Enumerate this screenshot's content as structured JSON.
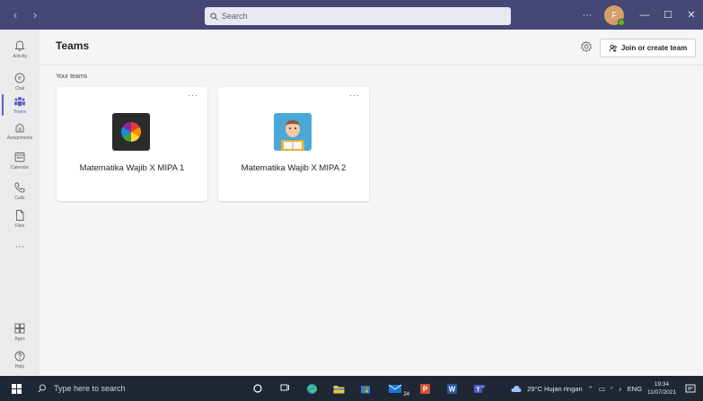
{
  "titlebar": {
    "search_placeholder": "Search",
    "more_label": "···",
    "avatar_initial": "F",
    "minimize": "—",
    "maximize": "☐",
    "close": "✕"
  },
  "rail": [
    {
      "label": "Activity",
      "icon": "bell-icon"
    },
    {
      "label": "Chat",
      "icon": "chat-icon"
    },
    {
      "label": "Teams",
      "icon": "teams-icon",
      "active": true
    },
    {
      "label": "Assignments",
      "icon": "assignments-icon"
    },
    {
      "label": "Calendar",
      "icon": "calendar-icon"
    },
    {
      "label": "Calls",
      "icon": "phone-icon"
    },
    {
      "label": "Files",
      "icon": "file-icon"
    }
  ],
  "rail_more": "···",
  "rail_bottom": [
    {
      "label": "Apps",
      "icon": "apps-icon"
    },
    {
      "label": "Help",
      "icon": "help-icon"
    }
  ],
  "header": {
    "title": "Teams",
    "join_button": "Join or create team"
  },
  "section_label": "Your teams",
  "teams": [
    {
      "name": "Matematika Wajib X MIPA 1",
      "more": "···"
    },
    {
      "name": "Matematika Wajib X MIPA 2",
      "more": "···"
    }
  ],
  "taskbar": {
    "search_placeholder": "Type here to search",
    "weather": "29°C  Hujan ringan",
    "lang": "ENG",
    "time": "19:34",
    "date": "11/07/2021",
    "mail_badge": "24"
  },
  "colors": {
    "titlebar": "#464775",
    "accent": "#5b5fc7",
    "taskbar": "#1f2735"
  }
}
